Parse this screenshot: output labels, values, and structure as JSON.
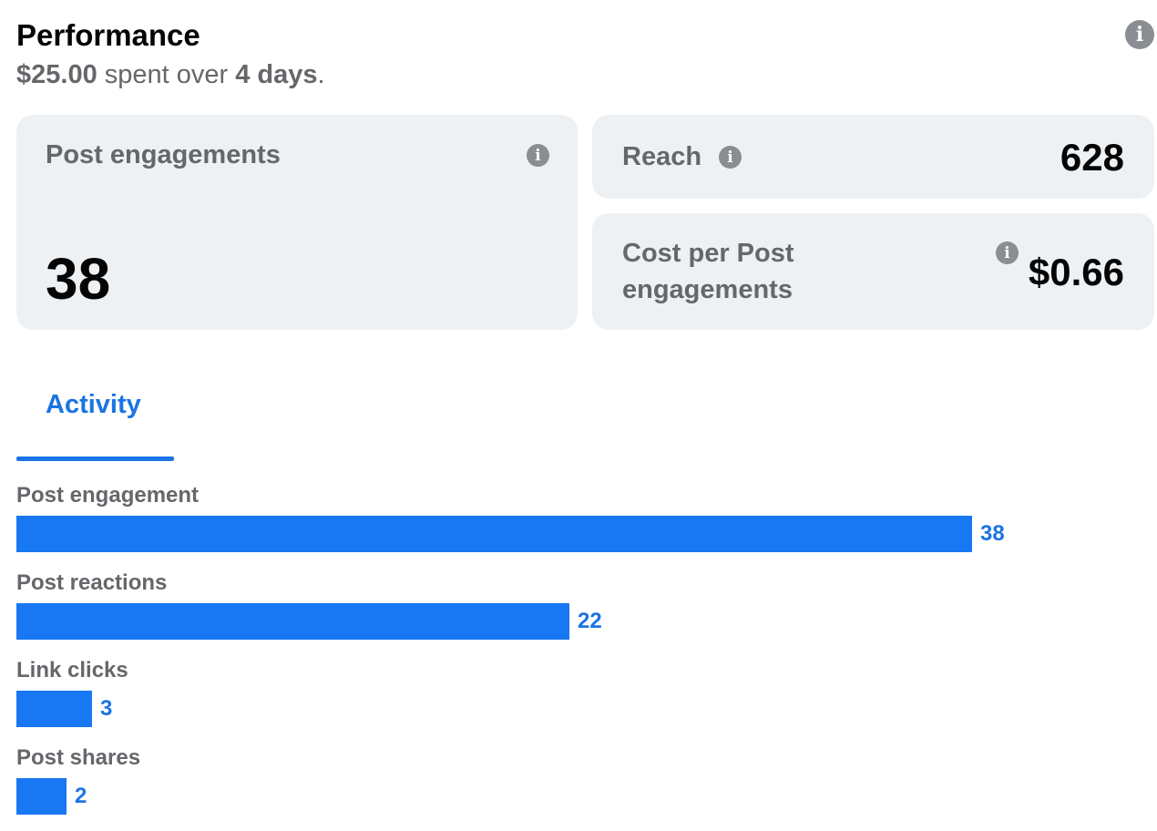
{
  "header": {
    "title": "Performance",
    "amount": "$25.00",
    "spent_over": "spent over",
    "duration": "4 days",
    "period": "."
  },
  "cards": {
    "post_engagements": {
      "label": "Post engagements",
      "value": "38"
    },
    "reach": {
      "label": "Reach",
      "value": "628"
    },
    "cost_per": {
      "label_line1": "Cost per Post",
      "label_line2": "engagements",
      "value": "$0.66"
    }
  },
  "tabs": [
    {
      "label": "Activity",
      "active": true
    }
  ],
  "info_icon_glyph": "i",
  "colors": {
    "accent": "#1877f2",
    "card_bg": "#eef1f4",
    "muted_text": "#65676b"
  },
  "activity": {
    "max": 38,
    "items": [
      {
        "label": "Post engagement",
        "value": 38,
        "display": "38"
      },
      {
        "label": "Post reactions",
        "value": 22,
        "display": "22"
      },
      {
        "label": "Link clicks",
        "value": 3,
        "display": "3"
      },
      {
        "label": "Post shares",
        "value": 2,
        "display": "2"
      }
    ]
  }
}
